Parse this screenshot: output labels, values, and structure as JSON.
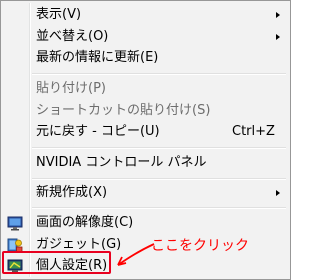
{
  "menu": {
    "view_label": "表示(V)",
    "sort_label": "並べ替え(O)",
    "refresh_label": "最新の情報に更新(E)",
    "paste_label": "貼り付け(P)",
    "paste_shortcut_label": "ショートカットの貼り付け(S)",
    "undo_label": "元に戻す - コピー(U)",
    "undo_shortcut": "Ctrl+Z",
    "nvidia_label": "NVIDIA コントロール パネル",
    "new_label": "新規作成(X)",
    "resolution_label": "画面の解像度(C)",
    "gadgets_label": "ガジェット(G)",
    "personalize_label": "個人設定(R)"
  },
  "annotation": {
    "callout_text": "ここをクリック",
    "color": "#ff0000"
  },
  "icons": {
    "resolution": "monitor-icon",
    "gadgets": "gadgets-icon",
    "personalize": "personalize-icon"
  }
}
